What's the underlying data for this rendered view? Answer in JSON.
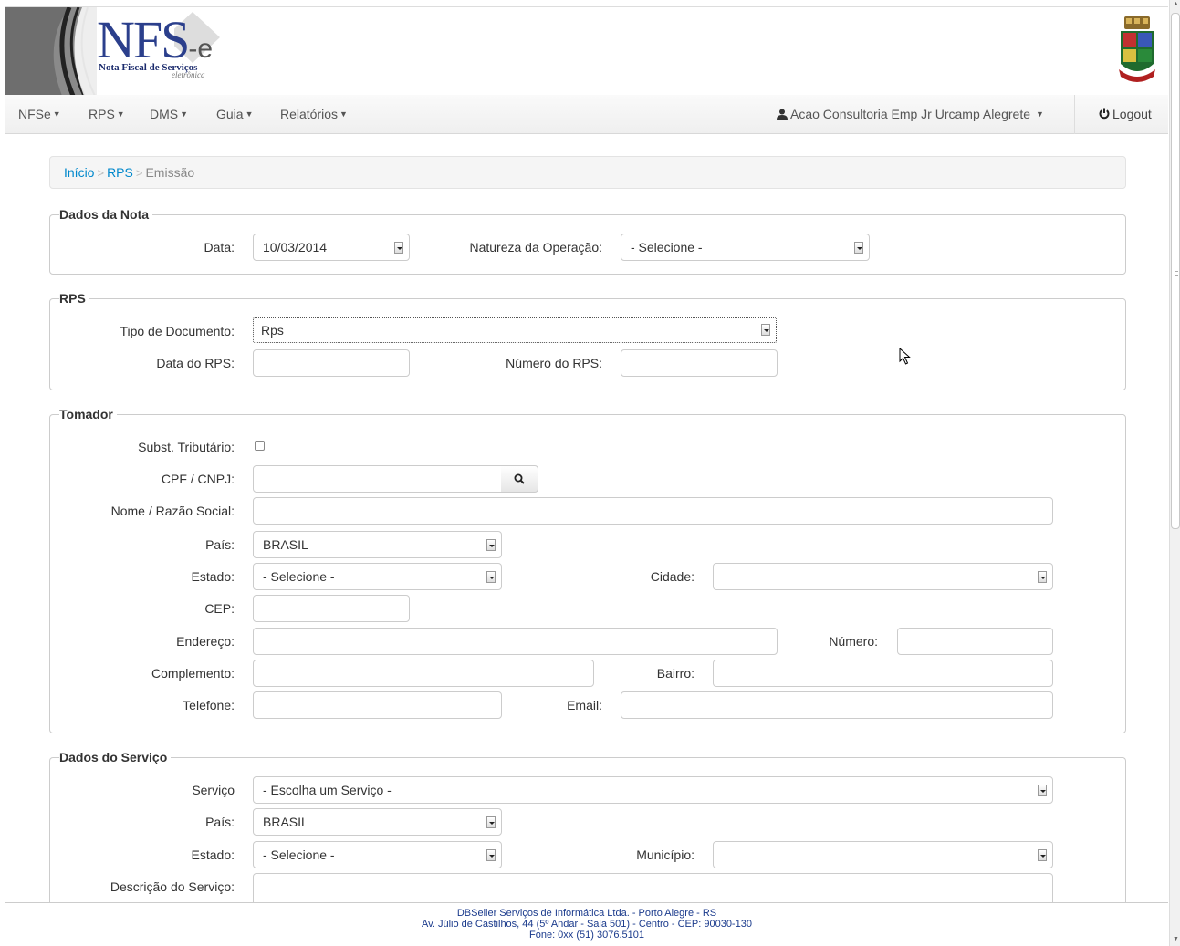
{
  "header": {
    "logo_main": "NFS",
    "logo_suffix": "-e",
    "logo_subtitle": "Nota Fiscal de Serviços",
    "logo_subtitle2": "eletrônica"
  },
  "nav": {
    "items": [
      {
        "label": "NFSe"
      },
      {
        "label": "RPS"
      },
      {
        "label": "DMS"
      },
      {
        "label": "Guia"
      },
      {
        "label": "Relatórios"
      }
    ],
    "user": "Acao Consultoria Emp Jr Urcamp Alegrete",
    "logout": "Logout"
  },
  "breadcrumb": {
    "home": "Início",
    "section": "RPS",
    "current": "Emissão",
    "separator": ">"
  },
  "dados_nota": {
    "legend": "Dados da Nota",
    "data_label": "Data:",
    "data_value": "10/03/2014",
    "natureza_label": "Natureza da Operação:",
    "natureza_value": "- Selecione -"
  },
  "rps": {
    "legend": "RPS",
    "tipo_label": "Tipo de Documento:",
    "tipo_value": "Rps",
    "data_label": "Data do RPS:",
    "data_value": "",
    "numero_label": "Número do RPS:",
    "numero_value": ""
  },
  "tomador": {
    "legend": "Tomador",
    "subst_label": "Subst. Tributário:",
    "cpf_label": "CPF / CNPJ:",
    "cpf_value": "",
    "nome_label": "Nome / Razão Social:",
    "nome_value": "",
    "pais_label": "País:",
    "pais_value": "BRASIL",
    "estado_label": "Estado:",
    "estado_value": "- Selecione -",
    "cidade_label": "Cidade:",
    "cidade_value": "",
    "cep_label": "CEP:",
    "cep_value": "",
    "endereco_label": "Endereço:",
    "endereco_value": "",
    "numero_label": "Número:",
    "numero_value": "",
    "complemento_label": "Complemento:",
    "complemento_value": "",
    "bairro_label": "Bairro:",
    "bairro_value": "",
    "telefone_label": "Telefone:",
    "telefone_value": "",
    "email_label": "Email:",
    "email_value": ""
  },
  "servico": {
    "legend": "Dados do Serviço",
    "servico_label": "Serviço",
    "servico_value": "- Escolha um Serviço -",
    "pais_label": "País:",
    "pais_value": "BRASIL",
    "estado_label": "Estado:",
    "estado_value": "- Selecione -",
    "municipio_label": "Município:",
    "municipio_value": "",
    "descricao_label": "Descrição do Serviço:",
    "descricao_value": ""
  },
  "footer": {
    "line1": "DBSeller Serviços de Informática Ltda. - Porto Alegre - RS",
    "line2": "Av. Júlio de Castilhos, 44 (5º Andar - Sala 501) - Centro - CEP: 90030-130",
    "line3": "Fone: 0xx (51) 3076.5101"
  },
  "colors": {
    "link": "#0088cc",
    "logo_blue": "#2b3f8c",
    "footer_text": "#1a3a8c"
  }
}
